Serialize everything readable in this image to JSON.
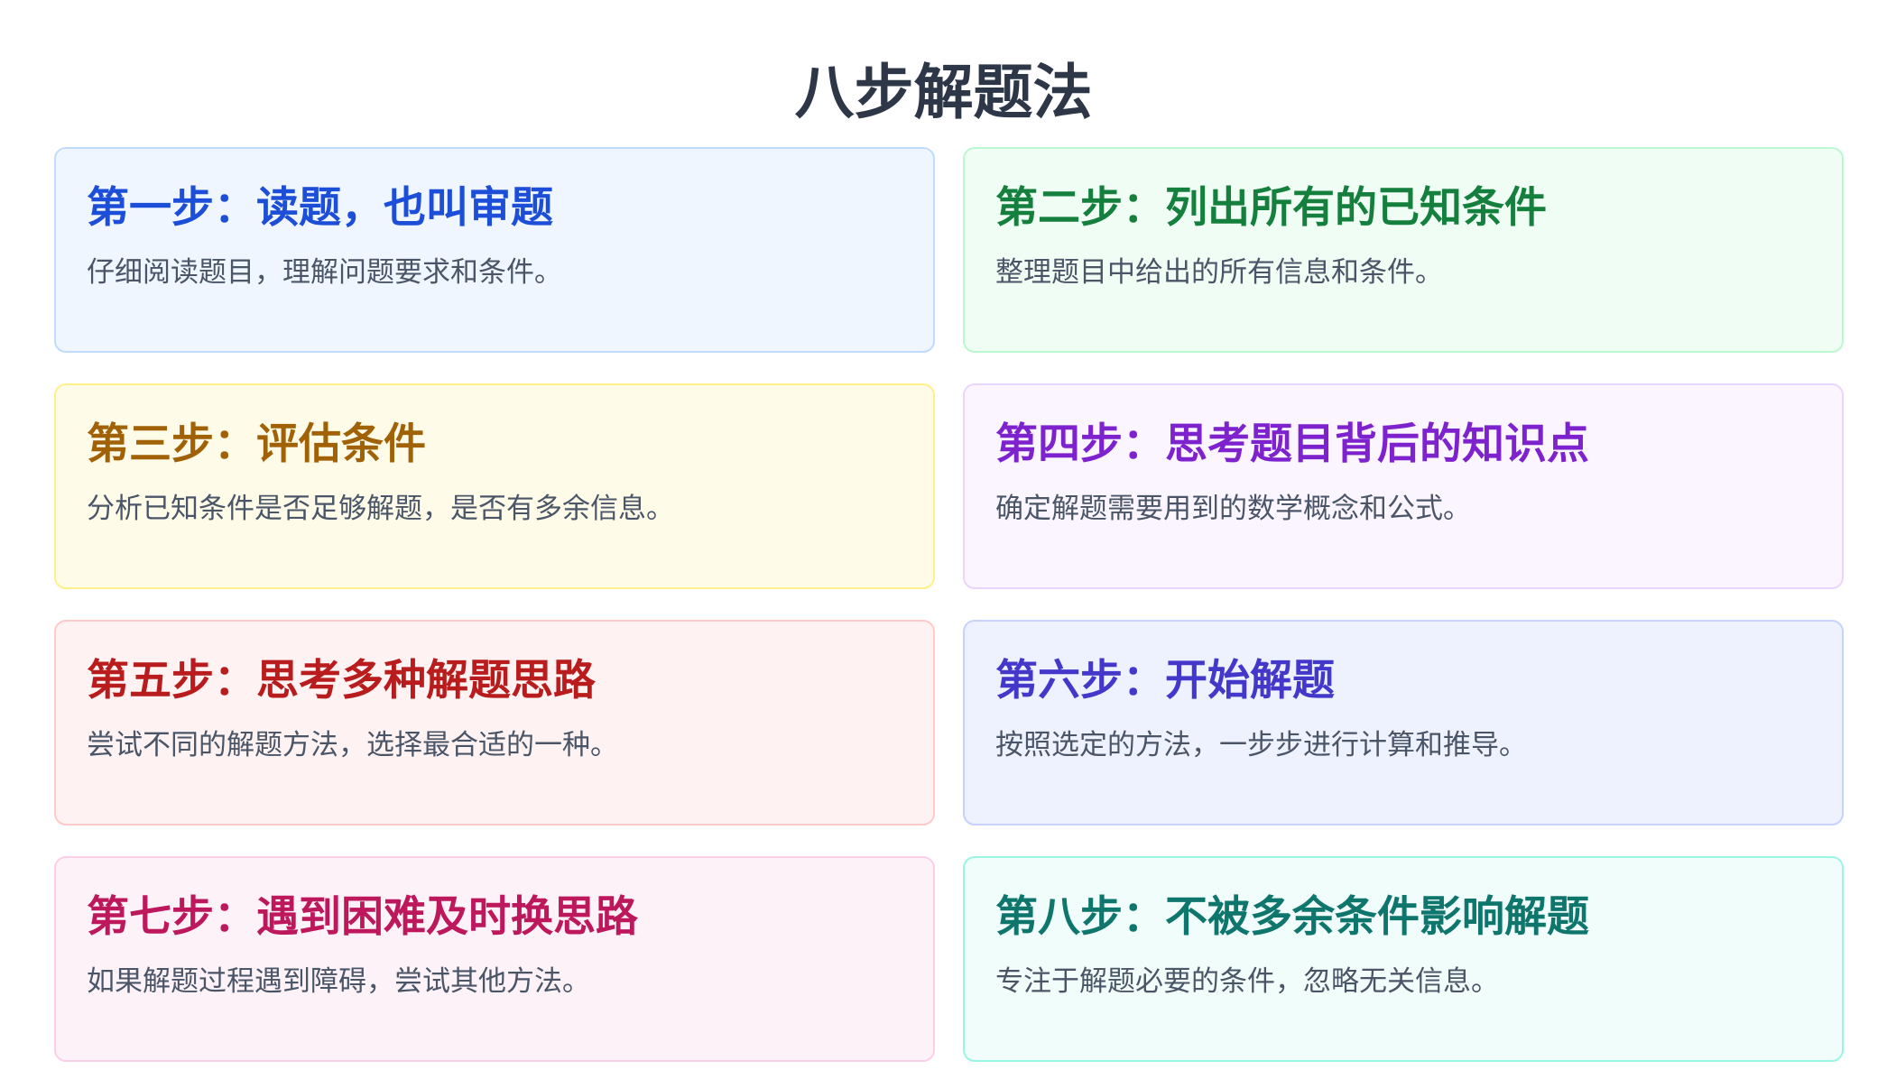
{
  "title": "八步解题法",
  "colors": {
    "title": "#2d3748",
    "description": "#4a5568",
    "step1": "#1d4ed8",
    "step2": "#15803d",
    "step3": "#a16207",
    "step4": "#7e22ce",
    "step5": "#b91c1c",
    "step6": "#4338ca",
    "step7": "#be185d",
    "step8": "#0f766e"
  },
  "steps": [
    {
      "title": "第一步：读题，也叫审题",
      "description": "仔细阅读题目，理解问题要求和条件。"
    },
    {
      "title": "第二步：列出所有的已知条件",
      "description": "整理题目中给出的所有信息和条件。"
    },
    {
      "title": "第三步：评估条件",
      "description": "分析已知条件是否足够解题，是否有多余信息。"
    },
    {
      "title": "第四步：思考题目背后的知识点",
      "description": "确定解题需要用到的数学概念和公式。"
    },
    {
      "title": "第五步：思考多种解题思路",
      "description": "尝试不同的解题方法，选择最合适的一种。"
    },
    {
      "title": "第六步：开始解题",
      "description": "按照选定的方法，一步步进行计算和推导。"
    },
    {
      "title": "第七步：遇到困难及时换思路",
      "description": "如果解题过程遇到障碍，尝试其他方法。"
    },
    {
      "title": "第八步：不被多余条件影响解题",
      "description": "专注于解题必要的条件，忽略无关信息。"
    }
  ]
}
